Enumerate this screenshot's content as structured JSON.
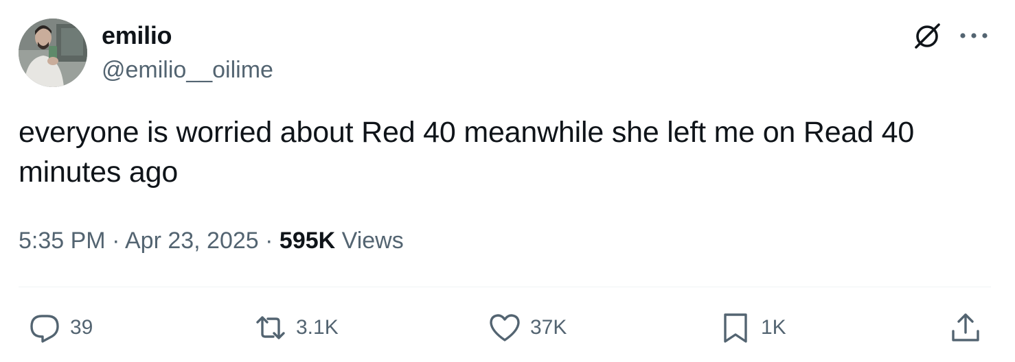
{
  "author": {
    "display_name": "emilio",
    "handle": "@emilio__oilime"
  },
  "tweet": {
    "text": "everyone is worried about Red 40 meanwhile she left me on Read 40 minutes ago"
  },
  "meta": {
    "time": "5:35 PM",
    "separator": "·",
    "date": "Apr 23, 2025",
    "views_count": "595K",
    "views_label": "Views"
  },
  "actions": {
    "replies": "39",
    "reposts": "3.1K",
    "likes": "37K",
    "bookmarks": "1K"
  },
  "icons": {
    "grok": "grok-icon",
    "more": "more-icon",
    "reply": "reply-icon",
    "retweet": "retweet-icon",
    "like": "heart-icon",
    "bookmark": "bookmark-icon",
    "share": "share-icon"
  },
  "colors": {
    "text_primary": "#0f1419",
    "text_secondary": "#536471",
    "divider": "#eff3f4"
  }
}
